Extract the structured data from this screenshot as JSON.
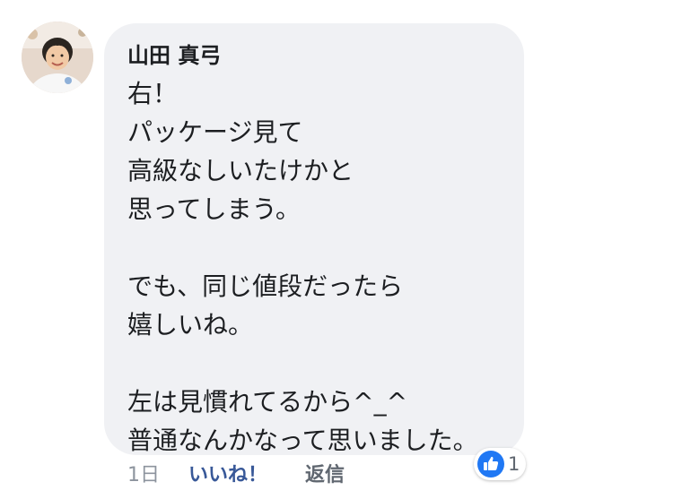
{
  "comment": {
    "author": "山田 真弓",
    "lines": [
      "右！",
      "パッケージ見て",
      "高級なしいたけかと",
      "思ってしまう。",
      "",
      "でも、同じ値段だったら",
      "嬉しいね。",
      "",
      "左は見慣れてるから^_^",
      "普通なんかなって思いました。"
    ],
    "time": "1日",
    "like_label": "いいね！",
    "reply_label": "返信",
    "reaction_count": "1"
  },
  "colors": {
    "bubble": "#f0f1f4",
    "like_link": "#385898",
    "like_badge": "#2078f4",
    "text": "#1c1e21"
  }
}
